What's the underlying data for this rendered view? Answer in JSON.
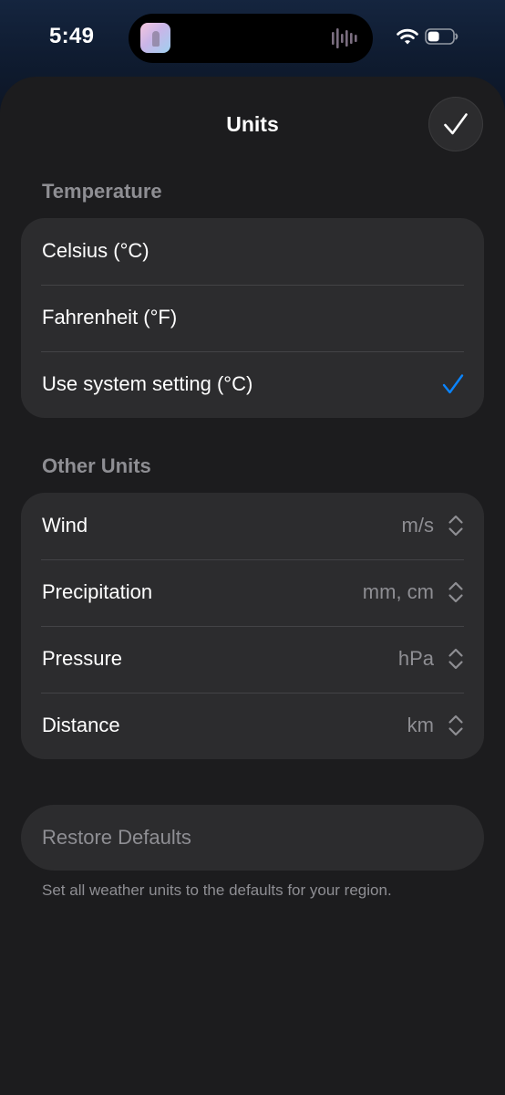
{
  "status_bar": {
    "time": "5:49"
  },
  "sheet": {
    "title": "Units",
    "done_icon": "checkmark-icon"
  },
  "temperature": {
    "header": "Temperature",
    "options": [
      {
        "label": "Celsius (°C)",
        "selected": false
      },
      {
        "label": "Fahrenheit (°F)",
        "selected": false
      },
      {
        "label": "Use system setting (°C)",
        "selected": true
      }
    ]
  },
  "other_units": {
    "header": "Other Units",
    "rows": [
      {
        "label": "Wind",
        "value": "m/s"
      },
      {
        "label": "Precipitation",
        "value": "mm, cm"
      },
      {
        "label": "Pressure",
        "value": "hPa"
      },
      {
        "label": "Distance",
        "value": "km"
      }
    ]
  },
  "restore": {
    "label": "Restore Defaults",
    "footnote": "Set all weather units to the defaults for your region."
  },
  "colors": {
    "accent": "#0a84ff",
    "sheet_background": "#1c1c1e",
    "group_background": "#2c2c2e",
    "secondary_text": "#8e8e93"
  }
}
